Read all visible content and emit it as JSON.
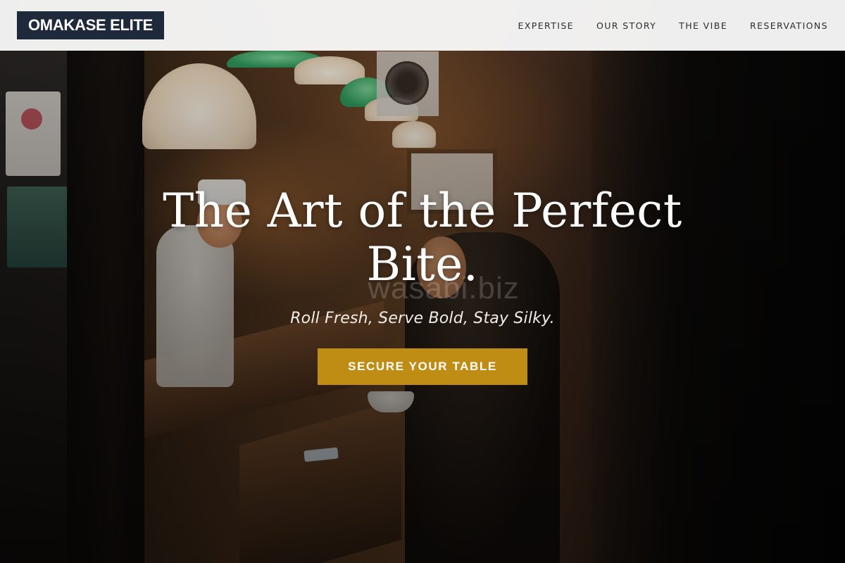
{
  "brand": {
    "name": "OMAKASE ELITE"
  },
  "nav": {
    "items": [
      {
        "label": "EXPERTISE"
      },
      {
        "label": "OUR STORY"
      },
      {
        "label": "THE VIBE"
      },
      {
        "label": "RESERVATIONS"
      }
    ]
  },
  "hero": {
    "title": "The Art of the Perfect Bite.",
    "tagline": "Roll Fresh, Serve Bold, Stay Silky.",
    "cta_label": "SECURE YOUR TABLE",
    "watermark": "wasabi.biz"
  },
  "colors": {
    "brand_background": "#1e2a3c",
    "cta_background": "#c08d14",
    "nav_background": "#f8f8f8"
  }
}
